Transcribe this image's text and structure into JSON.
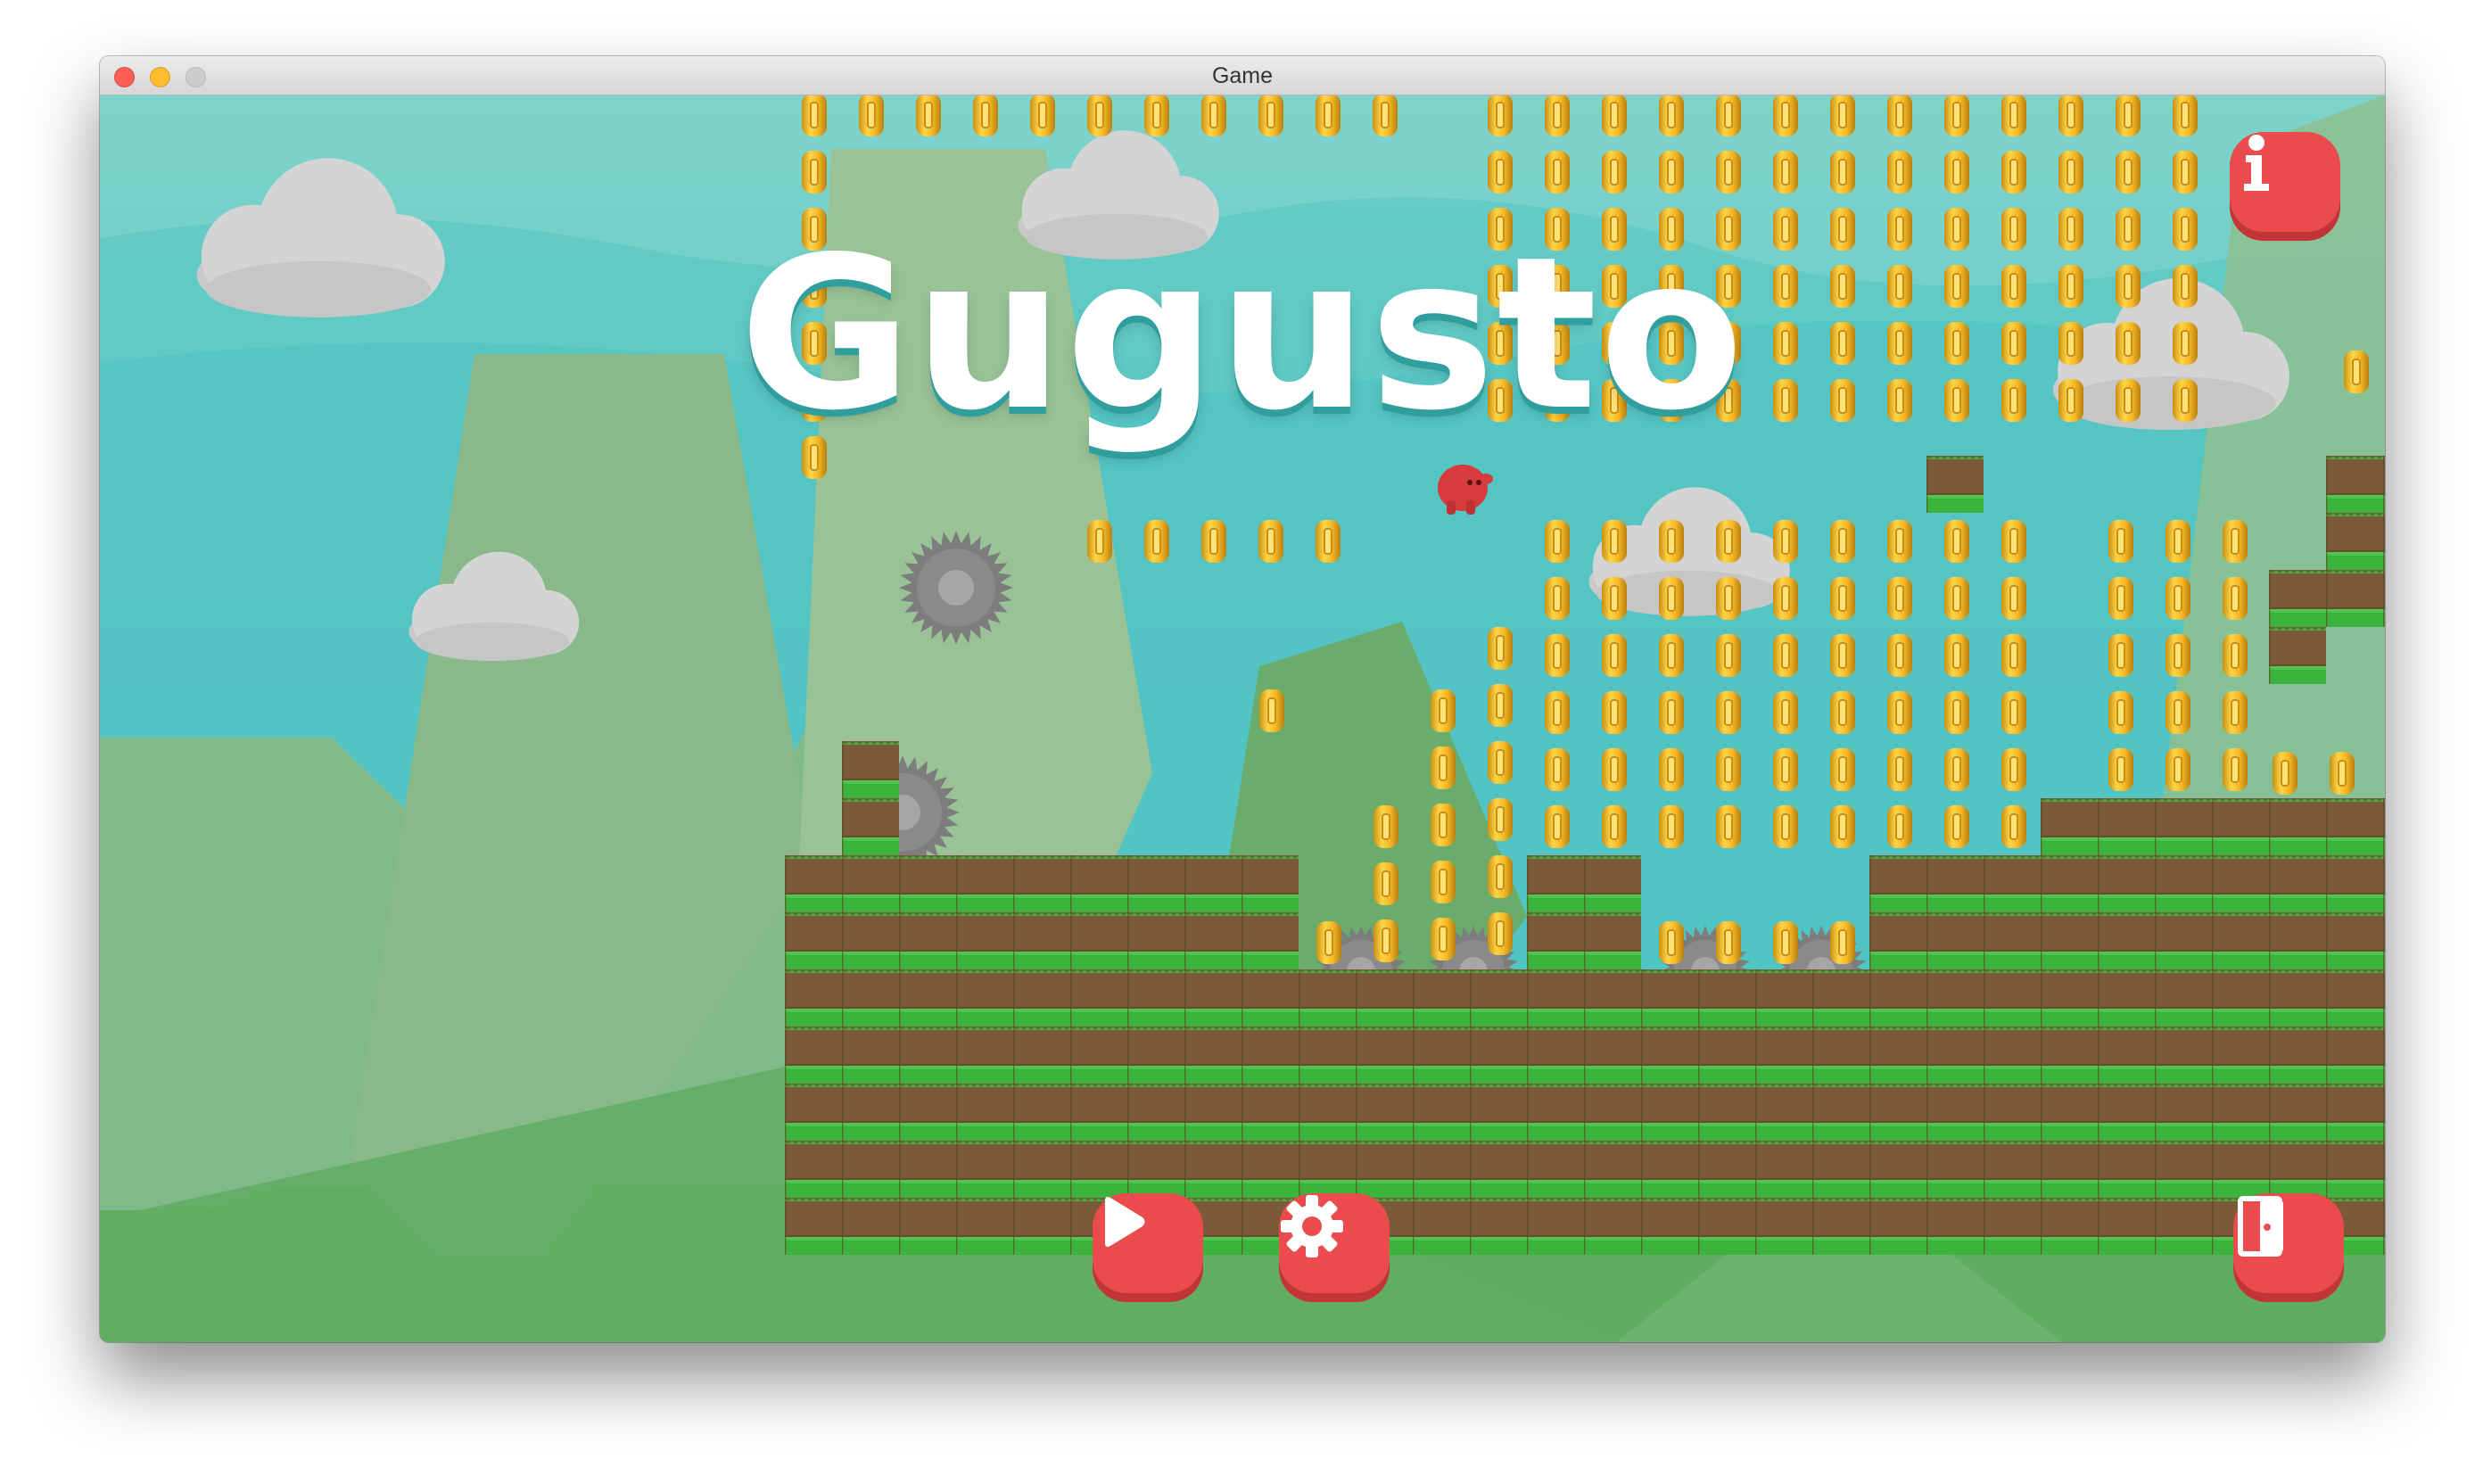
{
  "window": {
    "title": "Game",
    "traffic_lights": [
      "close",
      "minimize",
      "maximize"
    ]
  },
  "game": {
    "title": "Gugusto",
    "buttons": [
      {
        "name": "play",
        "icon": "play-icon"
      },
      {
        "name": "settings",
        "icon": "gear-icon"
      },
      {
        "name": "info",
        "icon": "info-icon"
      },
      {
        "name": "exit",
        "icon": "exit-door-icon"
      }
    ]
  },
  "colors": {
    "sky": "#5cc9c5",
    "grass": "#3bb33c",
    "dirt": "#7a5a38",
    "button": "#ea4c4e",
    "coin": "#f2bd2a",
    "player": "#d63b3d",
    "saw": "#7d7d7d"
  }
}
